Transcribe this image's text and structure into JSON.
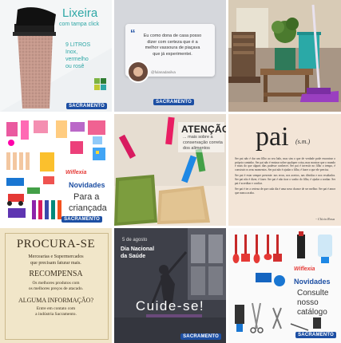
{
  "tile1": {
    "title": "Lixeira",
    "subtitle": "com tampa click",
    "details": [
      "9 LITROS",
      "Inox,",
      "vermelho",
      "ou rosê"
    ],
    "brand": "SACRAMENTO"
  },
  "tile2": {
    "quote_lines": [
      "Eu como dona de casa posso",
      "dizer com certeza que é a",
      "melhor vassoura de piaçava",
      "que já experimentei."
    ],
    "author": "@fulanadasilva",
    "brand": "SACRAMENTO"
  },
  "tile4": {
    "logo": "Wiflexia",
    "text_lines": [
      "Novidades",
      "Para a",
      "criançada"
    ],
    "brand": "SACRAMENTO"
  },
  "tile5": {
    "title": "ATENÇÃO",
    "body_lines": [
      "... mais sobre a",
      "conservação correta",
      "dos alimentos"
    ]
  },
  "tile6": {
    "word": "pai",
    "pos": "(s.m.)",
    "paragraphs": [
      "Ser pai não é dar um filho ao seu lado, mas sim o que de verdade pode encontrar o próprio caminho. Ser pai não é ensinar sobre qualquer coisa, mas mostrar que o mundo é mais do que alguns dias pudesse conhecer. Ser pai é investir no filho o tempo, é construir os seus momentos. Ser pai não é ajudar o filho, é fazer o que ele precisa.",
      "Ser pai é estar sempre presente: nos erros, nos acertos, nas dúvidas e nos resultados. Ser pai não é dizer, é fazer. Ser pai é não tirar o sonho do filho, é ajudar a sonhar. Ser pai é acreditar e confiar.",
      "Ser pai é ter a certeza de que cada dia é uma nova chance de ser melhor. Ser pai é amor que nunca acaba."
    ],
    "signature": "- Clícia Rosa"
  },
  "tile7": {
    "title": "PROCURA-SE",
    "line1": [
      "Mercearias e Supermercados",
      "que precisam faturar mais."
    ],
    "heading2": "RECOMPENSA",
    "line2": [
      "Os melhores produtos com",
      "os melhores preços de atacado."
    ],
    "heading3": "ALGUMA INFORMAÇÃO?",
    "line3": [
      "Entre em contato com",
      "a indústria Sacramento."
    ]
  },
  "tile8": {
    "date": "5 de agosto",
    "title_lines": [
      "Dia Nacional",
      "da Saúde"
    ],
    "cta": "Cuide-se!",
    "brand": "SACRAMENTO"
  },
  "tile9": {
    "logo": "Wiflexia",
    "text_lines": [
      "Novidades",
      "Consulte",
      "nosso",
      "catálogo"
    ],
    "brand": "SACRAMENTO"
  },
  "colors": {
    "brand_blue": "#1d4fa3",
    "teal": "#2ea7a6",
    "green": "#7cb342",
    "red": "#e53935"
  }
}
